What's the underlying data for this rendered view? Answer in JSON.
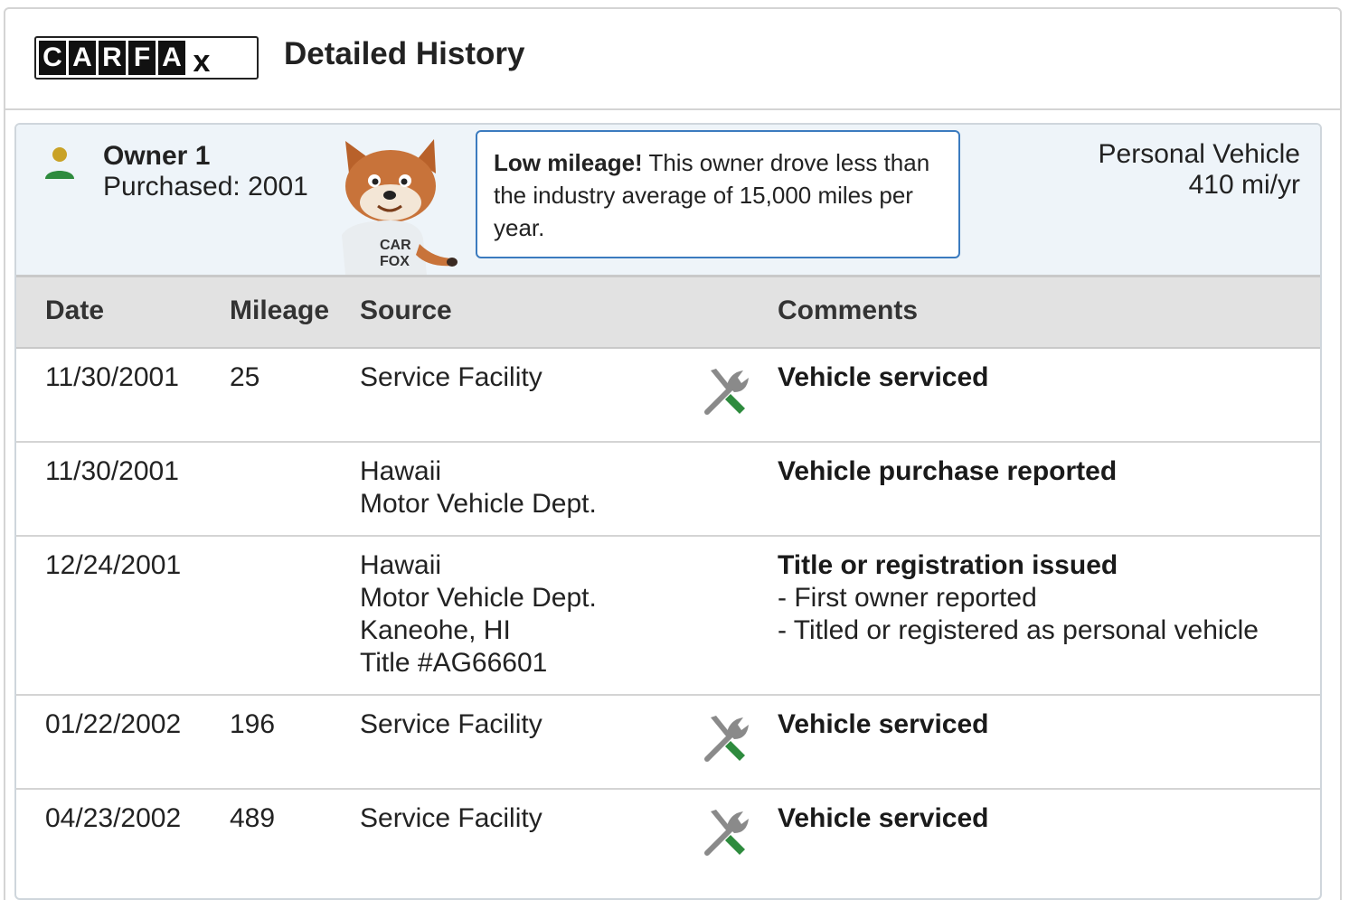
{
  "header": {
    "logo_letters": [
      "C",
      "A",
      "R",
      "F",
      "A",
      "x"
    ],
    "title": "Detailed History"
  },
  "owner": {
    "name": "Owner 1",
    "purchased": "Purchased: 2001",
    "mascot_shirt": "CAR FOX",
    "callout_bold": "Low mileage!",
    "callout_text": " This owner drove less than the industry average of 15,000 miles per year.",
    "vehicle_type": "Personal Vehicle",
    "annual_miles": "410 mi/yr"
  },
  "table": {
    "columns": [
      "Date",
      "Mileage",
      "Source",
      "Comments"
    ],
    "rows": [
      {
        "date": "11/30/2001",
        "mileage": "25",
        "source": [
          "Service Facility"
        ],
        "icon": "service-icon",
        "comment_title": "Vehicle serviced",
        "comment_details": []
      },
      {
        "date": "11/30/2001",
        "mileage": "",
        "source": [
          "Hawaii",
          "Motor Vehicle Dept."
        ],
        "icon": "",
        "comment_title": "Vehicle purchase reported",
        "comment_details": []
      },
      {
        "date": "12/24/2001",
        "mileage": "",
        "source": [
          "Hawaii",
          "Motor Vehicle Dept.",
          "Kaneohe, HI",
          "Title #AG66601"
        ],
        "icon": "",
        "comment_title": "Title or registration issued",
        "comment_details": [
          "- First owner reported",
          "- Titled or registered as personal vehicle"
        ]
      },
      {
        "date": "01/22/2002",
        "mileage": "196",
        "source": [
          "Service Facility"
        ],
        "icon": "service-icon",
        "comment_title": "Vehicle serviced",
        "comment_details": []
      },
      {
        "date": "04/23/2002",
        "mileage": "489",
        "source": [
          "Service Facility"
        ],
        "icon": "service-icon",
        "comment_title": "Vehicle serviced",
        "comment_details": []
      }
    ]
  },
  "colors": {
    "owner_bar_bg": "#eef4f9",
    "callout_border": "#3b7bbf",
    "person_head": "#c9a227",
    "person_body": "#2e8b3e",
    "tool_gray": "#8a8a8a",
    "tool_green": "#2e8b3e"
  }
}
